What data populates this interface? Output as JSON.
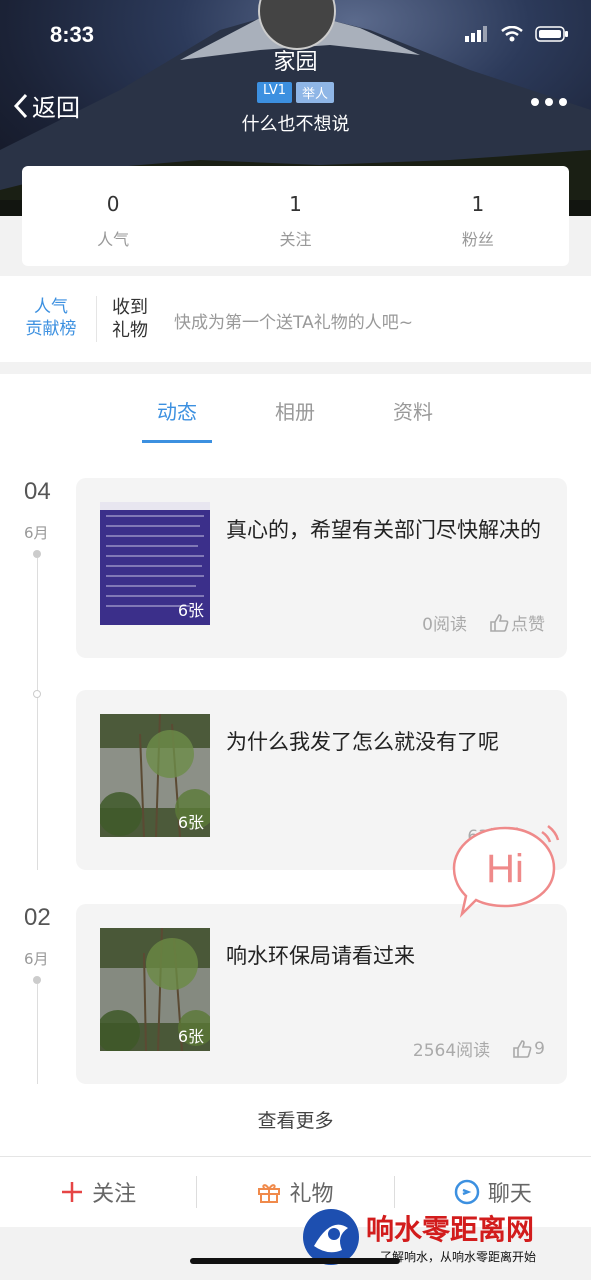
{
  "status": {
    "time": "8:33"
  },
  "header": {
    "back_label": "返回",
    "title": "家园",
    "level_badge": "LV1",
    "role_badge": "举人",
    "signature": "什么也不想说"
  },
  "stats": [
    {
      "value": "0",
      "label": "人气"
    },
    {
      "value": "1",
      "label": "关注"
    },
    {
      "value": "1",
      "label": "粉丝"
    }
  ],
  "gift": {
    "rank_line1": "人气",
    "rank_line2": "贡献榜",
    "received_line1": "收到",
    "received_line2": "礼物",
    "hint": "快成为第一个送TA礼物的人吧~"
  },
  "tabs": [
    "动态",
    "相册",
    "资料"
  ],
  "feed": {
    "groups": [
      {
        "day": "04",
        "month": "6月"
      },
      {
        "day": "02",
        "month": "6月"
      }
    ],
    "posts": [
      {
        "text": "真心的，希望有关部门尽快解决的",
        "photo_count": "6张",
        "reads": "0阅读",
        "likes": "点赞"
      },
      {
        "text": "为什么我发了怎么就没有了呢",
        "photo_count": "6张",
        "reads": "63阅读",
        "likes": ""
      },
      {
        "text": "响水环保局请看过来",
        "photo_count": "6张",
        "reads": "2564阅读",
        "likes": "9"
      }
    ],
    "more_label": "查看更多"
  },
  "hi_label": "Hi",
  "bottom_bar": [
    {
      "label": "关注",
      "icon": "plus-icon"
    },
    {
      "label": "礼物",
      "icon": "gift-icon"
    },
    {
      "label": "聊天",
      "icon": "chat-icon"
    }
  ],
  "watermark": {
    "title": "响水零距离网",
    "subtitle": "了解响水，从响水零距离开始"
  },
  "colors": {
    "accent": "#3c90e0",
    "follow": "#e64545",
    "gift": "#f08a4b",
    "chat": "#3c90e0"
  }
}
